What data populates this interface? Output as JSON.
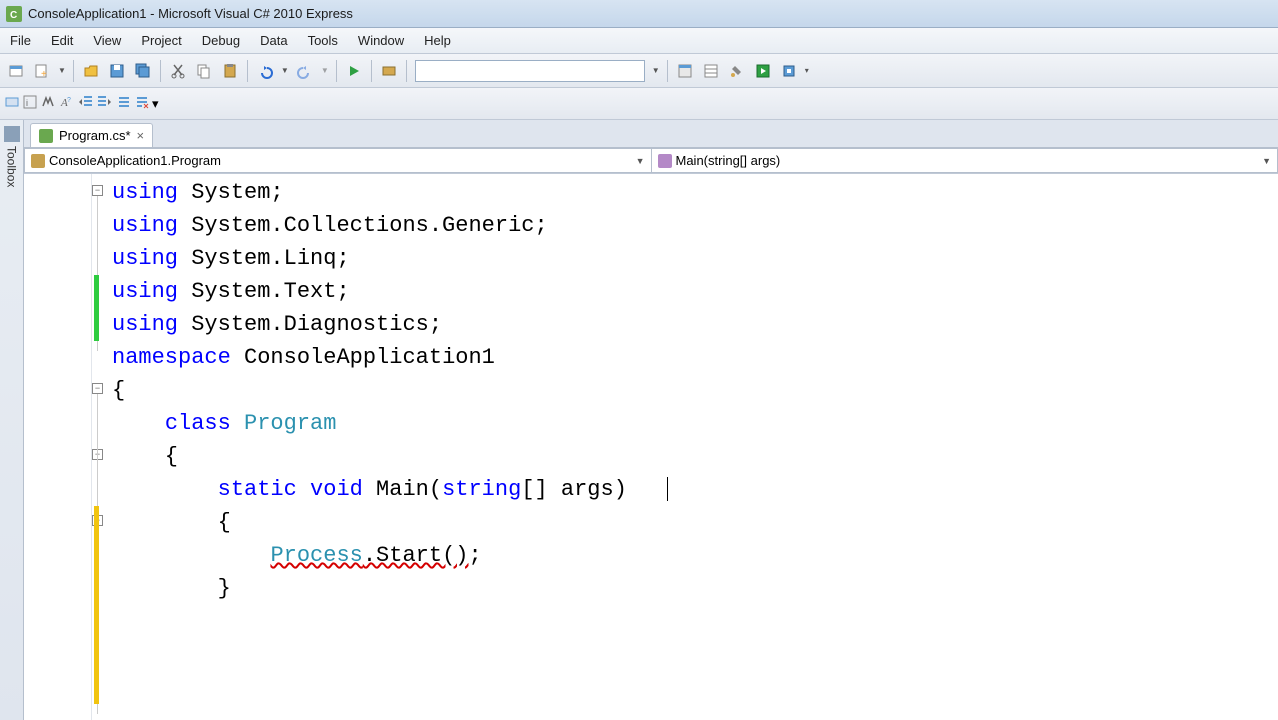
{
  "window": {
    "title": "ConsoleApplication1 - Microsoft Visual C# 2010 Express"
  },
  "menu": {
    "file": "File",
    "edit": "Edit",
    "view": "View",
    "project": "Project",
    "debug": "Debug",
    "data": "Data",
    "tools": "Tools",
    "window": "Window",
    "help": "Help"
  },
  "toolbox": {
    "label": "Toolbox"
  },
  "tab": {
    "filename": "Program.cs*"
  },
  "nav": {
    "class": "ConsoleApplication1.Program",
    "member": "Main(string[] args)"
  },
  "code": {
    "lines": [
      {
        "tokens": [
          [
            "kw",
            "using"
          ],
          [
            "",
            " System;"
          ]
        ]
      },
      {
        "tokens": [
          [
            "kw",
            "using"
          ],
          [
            "",
            " System.Collections.Generic;"
          ]
        ]
      },
      {
        "tokens": [
          [
            "kw",
            "using"
          ],
          [
            "",
            " System.Linq;"
          ]
        ]
      },
      {
        "tokens": [
          [
            "kw",
            "using"
          ],
          [
            "",
            " System.Text;"
          ]
        ]
      },
      {
        "tokens": [
          [
            "kw",
            "using"
          ],
          [
            "",
            " System.Diagnostics;"
          ]
        ]
      },
      {
        "tokens": [
          [
            "",
            ""
          ]
        ]
      },
      {
        "tokens": [
          [
            "kw",
            "namespace"
          ],
          [
            "",
            " ConsoleApplication1"
          ]
        ]
      },
      {
        "tokens": [
          [
            "",
            "{"
          ]
        ]
      },
      {
        "tokens": [
          [
            "",
            "    "
          ],
          [
            "kw",
            "class"
          ],
          [
            "",
            " "
          ],
          [
            "typ",
            "Program"
          ]
        ]
      },
      {
        "tokens": [
          [
            "",
            "    {"
          ]
        ]
      },
      {
        "tokens": [
          [
            "",
            "        "
          ],
          [
            "kw",
            "static"
          ],
          [
            "",
            " "
          ],
          [
            "kw",
            "void"
          ],
          [
            "",
            " Main("
          ],
          [
            "kw",
            "string"
          ],
          [
            "",
            "[] args)"
          ]
        ]
      },
      {
        "tokens": [
          [
            "",
            "        {"
          ]
        ]
      },
      {
        "tokens": [
          [
            "",
            ""
          ]
        ]
      },
      {
        "tokens": [
          [
            "",
            "            "
          ],
          [
            "typ err",
            "Process"
          ],
          [
            "err",
            ".Start()"
          ],
          [
            "",
            ";"
          ]
        ]
      },
      {
        "tokens": [
          [
            "",
            ""
          ]
        ]
      },
      {
        "tokens": [
          [
            "",
            "        }"
          ]
        ]
      }
    ],
    "outline_boxes": [
      0,
      6,
      8,
      10
    ],
    "change_markers": [
      {
        "type": "green",
        "from": 3,
        "to": 4
      },
      {
        "type": "yellow",
        "from": 10,
        "to": 15
      }
    ]
  },
  "icons": {
    "new_project": "new-project-icon",
    "add_item": "add-item-icon",
    "open": "open-folder-icon",
    "save": "save-icon",
    "save_all": "save-all-icon",
    "cut": "cut-icon",
    "copy": "copy-icon",
    "paste": "paste-icon",
    "undo": "undo-icon",
    "redo": "redo-icon",
    "start": "start-debug-icon",
    "stop": "stop-icon",
    "find_files": "find-in-files-icon",
    "comment": "comment-icon",
    "uncomment": "uncomment-icon"
  }
}
